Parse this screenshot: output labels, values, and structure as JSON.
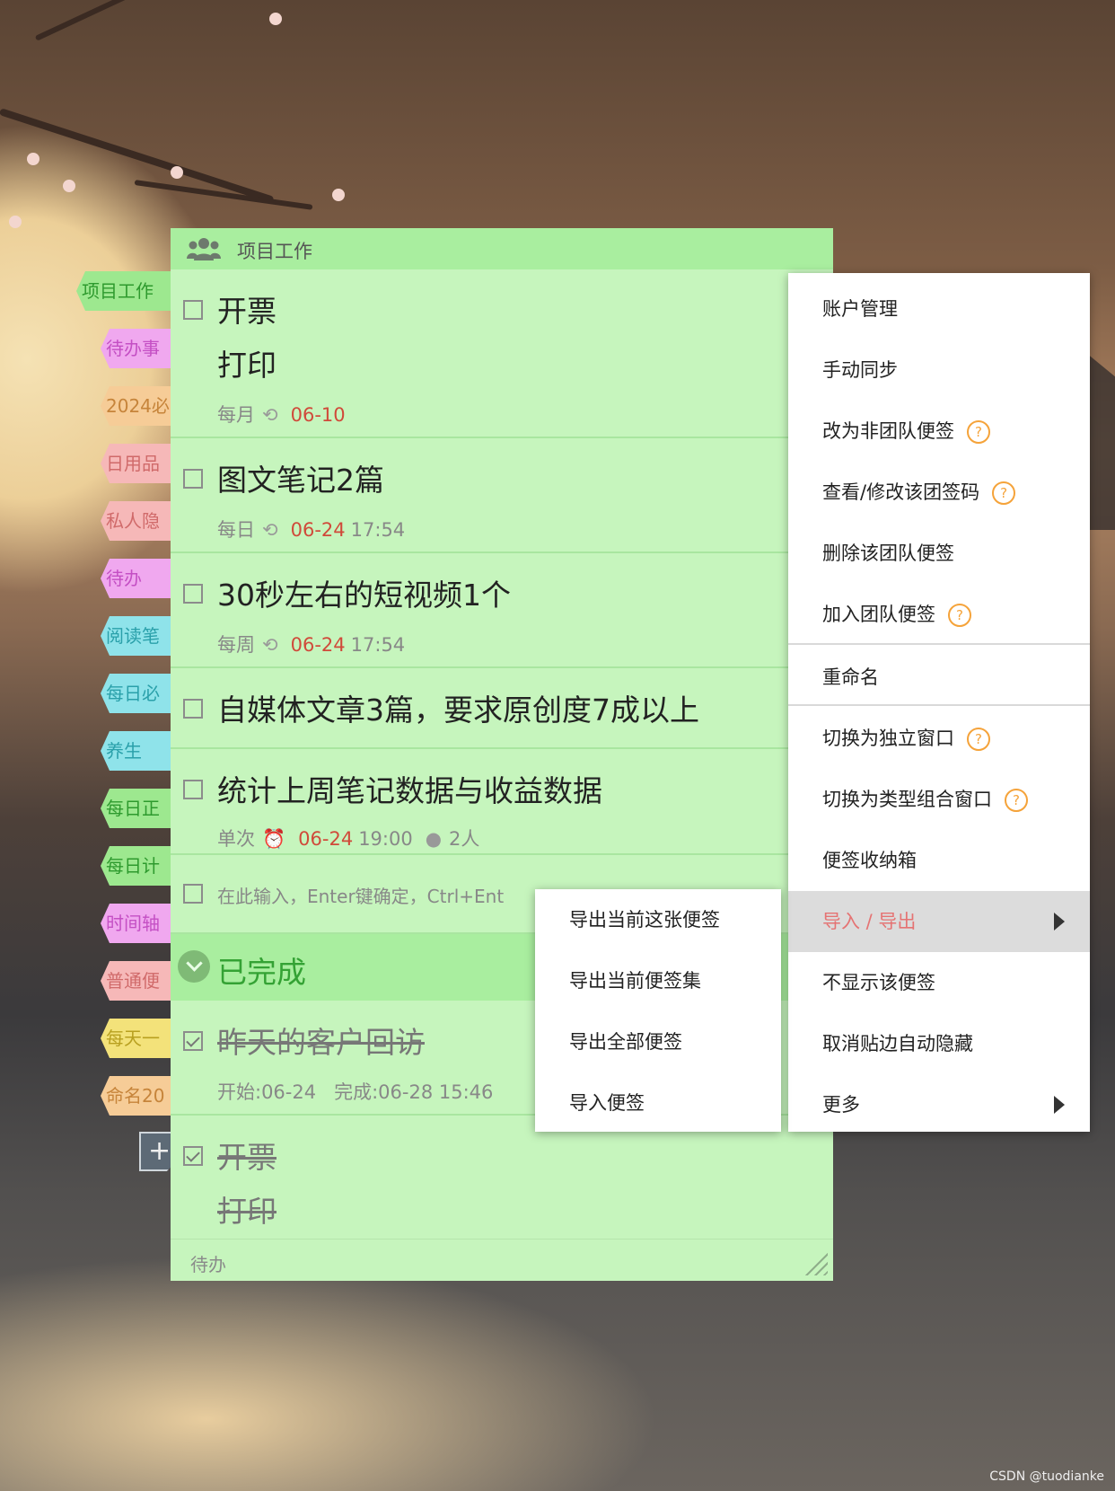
{
  "sidebar": {
    "tabs": [
      {
        "label": "项目工作",
        "bg": "#9de88f",
        "color": "#2e9a2e"
      },
      {
        "label": "待办事",
        "bg": "#f0a8ef",
        "color": "#c44fc4"
      },
      {
        "label": "2024必",
        "bg": "#f6cc97",
        "color": "#c6843a"
      },
      {
        "label": "日用品",
        "bg": "#f6b8b8",
        "color": "#d06a6a"
      },
      {
        "label": "私人隐",
        "bg": "#f6b8b8",
        "color": "#d06a6a"
      },
      {
        "label": "待办",
        "bg": "#f0a8ef",
        "color": "#c44fc4"
      },
      {
        "label": "阅读笔",
        "bg": "#8fe3ea",
        "color": "#2aa0aa"
      },
      {
        "label": "每日必",
        "bg": "#8fe3ea",
        "color": "#2aa0aa"
      },
      {
        "label": "养生",
        "bg": "#8fe3ea",
        "color": "#2aa0aa"
      },
      {
        "label": "每日正",
        "bg": "#9de88f",
        "color": "#2e9a2e"
      },
      {
        "label": "每日计",
        "bg": "#9de88f",
        "color": "#2e9a2e"
      },
      {
        "label": "时间轴",
        "bg": "#f0a8ef",
        "color": "#c44fc4"
      },
      {
        "label": "普通便",
        "bg": "#f6b8b8",
        "color": "#d06a6a"
      },
      {
        "label": "每天一",
        "bg": "#f3e27a",
        "color": "#b8a020"
      },
      {
        "label": "命名20",
        "bg": "#f6cc97",
        "color": "#c6843a"
      }
    ],
    "add_icon": "plus-icon"
  },
  "note": {
    "header_icon": "team-icon",
    "title": "项目工作",
    "tasks": [
      {
        "title": "开票",
        "subtitle": "打印",
        "repeat": "每月",
        "date": "06-10",
        "time": "",
        "icon": "repeat-icon"
      },
      {
        "title": "图文笔记2篇",
        "repeat": "每日",
        "date": "06-24",
        "time": "17:54",
        "icon": "repeat-icon"
      },
      {
        "title": "30秒左右的短视频1个",
        "repeat": "每周",
        "date": "06-24",
        "time": "17:54",
        "icon": "repeat-icon"
      },
      {
        "title": "自媒体文章3篇，要求原创度7成以上"
      },
      {
        "title": "统计上周笔记数据与收益数据",
        "repeat": "单次",
        "date": "06-24",
        "time": "19:00",
        "icon": "alarm-icon",
        "members": "2人"
      }
    ],
    "input_placeholder": "在此输入，Enter键确定，Ctrl+Ent",
    "completed_label": "已完成",
    "completed_tasks": [
      {
        "title": "昨天的客户回访",
        "start": "开始:06-24",
        "finish": "完成:06-28 15:46"
      },
      {
        "title": "开票",
        "subtitle": "打印"
      }
    ],
    "footer_label": "待办"
  },
  "context_menu": {
    "items": [
      {
        "label": "账户管理",
        "help": false
      },
      {
        "label": "手动同步",
        "help": false
      },
      {
        "label": "改为非团队便签",
        "help": true
      },
      {
        "label": "查看/修改该团签码",
        "help": true
      },
      {
        "label": "删除该团队便签",
        "help": false
      },
      {
        "label": "加入团队便签",
        "help": true
      },
      {
        "label": "重命名",
        "help": false
      },
      {
        "label": "切换为独立窗口",
        "help": true
      },
      {
        "label": "切换为类型组合窗口",
        "help": true
      },
      {
        "label": "便签收纳箱",
        "help": false
      },
      {
        "label": "导入 / 导出",
        "help": false,
        "submenu": true,
        "highlighted": true
      },
      {
        "label": "不显示该便签",
        "help": false
      },
      {
        "label": "取消贴边自动隐藏",
        "help": false
      },
      {
        "label": "更多",
        "help": false,
        "submenu": true
      }
    ],
    "help_glyph": "?"
  },
  "submenu": {
    "items": [
      {
        "label": "导出当前这张便签"
      },
      {
        "label": "导出当前便签集"
      },
      {
        "label": "导出全部便签"
      },
      {
        "label": "导入便签"
      }
    ]
  },
  "watermark": "CSDN @tuodianke",
  "colors": {
    "note_bg": "#c6f5bd",
    "note_header": "#a9ee9f",
    "date_red": "#d04a3a",
    "completed_green": "#34a234",
    "menu_highlight": "#dcdcdc",
    "menu_highlight_text": "#e57373",
    "help_orange": "#f5a33a"
  }
}
